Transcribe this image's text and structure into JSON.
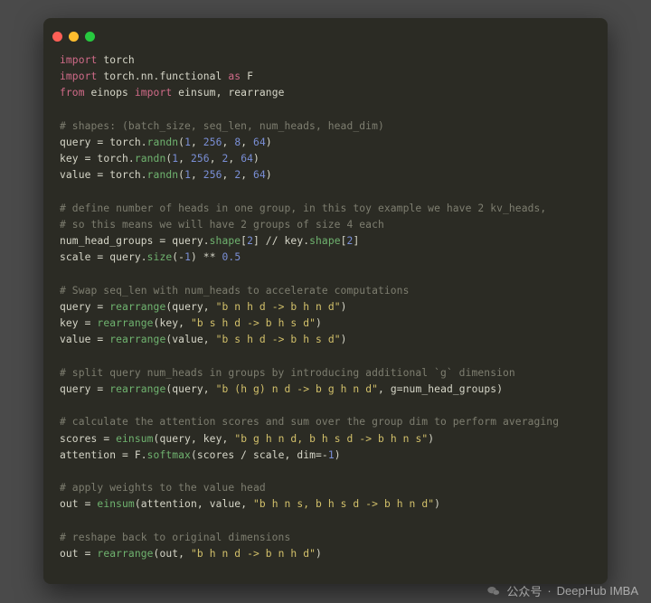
{
  "window": {
    "traffic_lights": [
      "close",
      "minimize",
      "zoom"
    ]
  },
  "code": {
    "lines": [
      [
        [
          "kw",
          "import"
        ],
        [
          "sp",
          " "
        ],
        [
          "mod",
          "torch"
        ]
      ],
      [
        [
          "kw",
          "import"
        ],
        [
          "sp",
          " "
        ],
        [
          "mod",
          "torch.nn.functional"
        ],
        [
          "sp",
          " "
        ],
        [
          "kw",
          "as"
        ],
        [
          "sp",
          " "
        ],
        [
          "mod",
          "F"
        ]
      ],
      [
        [
          "kw",
          "from"
        ],
        [
          "sp",
          " "
        ],
        [
          "mod",
          "einops"
        ],
        [
          "sp",
          " "
        ],
        [
          "kw",
          "import"
        ],
        [
          "sp",
          " "
        ],
        [
          "mod",
          "einsum, rearrange"
        ]
      ],
      [],
      [
        [
          "cmt",
          "# shapes: (batch_size, seq_len, num_heads, head_dim)"
        ]
      ],
      [
        [
          "mod",
          "query "
        ],
        [
          "op",
          "="
        ],
        [
          "sp",
          " "
        ],
        [
          "mod",
          "torch."
        ],
        [
          "fn",
          "randn"
        ],
        [
          "punct",
          "("
        ],
        [
          "num",
          "1"
        ],
        [
          "punct",
          ", "
        ],
        [
          "num",
          "256"
        ],
        [
          "punct",
          ", "
        ],
        [
          "num",
          "8"
        ],
        [
          "punct",
          ", "
        ],
        [
          "num",
          "64"
        ],
        [
          "punct",
          ")"
        ]
      ],
      [
        [
          "mod",
          "key "
        ],
        [
          "op",
          "="
        ],
        [
          "sp",
          " "
        ],
        [
          "mod",
          "torch."
        ],
        [
          "fn",
          "randn"
        ],
        [
          "punct",
          "("
        ],
        [
          "num",
          "1"
        ],
        [
          "punct",
          ", "
        ],
        [
          "num",
          "256"
        ],
        [
          "punct",
          ", "
        ],
        [
          "num",
          "2"
        ],
        [
          "punct",
          ", "
        ],
        [
          "num",
          "64"
        ],
        [
          "punct",
          ")"
        ]
      ],
      [
        [
          "mod",
          "value "
        ],
        [
          "op",
          "="
        ],
        [
          "sp",
          " "
        ],
        [
          "mod",
          "torch."
        ],
        [
          "fn",
          "randn"
        ],
        [
          "punct",
          "("
        ],
        [
          "num",
          "1"
        ],
        [
          "punct",
          ", "
        ],
        [
          "num",
          "256"
        ],
        [
          "punct",
          ", "
        ],
        [
          "num",
          "2"
        ],
        [
          "punct",
          ", "
        ],
        [
          "num",
          "64"
        ],
        [
          "punct",
          ")"
        ]
      ],
      [],
      [
        [
          "cmt",
          "# define number of heads in one group, in this toy example we have 2 kv_heads,"
        ]
      ],
      [
        [
          "cmt",
          "# so this means we will have 2 groups of size 4 each"
        ]
      ],
      [
        [
          "mod",
          "num_head_groups "
        ],
        [
          "op",
          "="
        ],
        [
          "sp",
          " "
        ],
        [
          "mod",
          "query."
        ],
        [
          "fn",
          "shape"
        ],
        [
          "punct",
          "["
        ],
        [
          "num",
          "2"
        ],
        [
          "punct",
          "] "
        ],
        [
          "op",
          "//"
        ],
        [
          "sp",
          " "
        ],
        [
          "mod",
          "key."
        ],
        [
          "fn",
          "shape"
        ],
        [
          "punct",
          "["
        ],
        [
          "num",
          "2"
        ],
        [
          "punct",
          "]"
        ]
      ],
      [
        [
          "mod",
          "scale "
        ],
        [
          "op",
          "="
        ],
        [
          "sp",
          " "
        ],
        [
          "mod",
          "query."
        ],
        [
          "fn",
          "size"
        ],
        [
          "punct",
          "("
        ],
        [
          "op",
          "-"
        ],
        [
          "num",
          "1"
        ],
        [
          "punct",
          ") "
        ],
        [
          "op",
          "**"
        ],
        [
          "sp",
          " "
        ],
        [
          "num",
          "0.5"
        ]
      ],
      [],
      [
        [
          "cmt",
          "# Swap seq_len with num_heads to accelerate computations"
        ]
      ],
      [
        [
          "mod",
          "query "
        ],
        [
          "op",
          "="
        ],
        [
          "sp",
          " "
        ],
        [
          "fn",
          "rearrange"
        ],
        [
          "punct",
          "("
        ],
        [
          "mod",
          "query"
        ],
        [
          "punct",
          ", "
        ],
        [
          "str",
          "\"b n h d -> b h n d\""
        ],
        [
          "punct",
          ")"
        ]
      ],
      [
        [
          "mod",
          "key "
        ],
        [
          "op",
          "="
        ],
        [
          "sp",
          " "
        ],
        [
          "fn",
          "rearrange"
        ],
        [
          "punct",
          "("
        ],
        [
          "mod",
          "key"
        ],
        [
          "punct",
          ", "
        ],
        [
          "str",
          "\"b s h d -> b h s d\""
        ],
        [
          "punct",
          ")"
        ]
      ],
      [
        [
          "mod",
          "value "
        ],
        [
          "op",
          "="
        ],
        [
          "sp",
          " "
        ],
        [
          "fn",
          "rearrange"
        ],
        [
          "punct",
          "("
        ],
        [
          "mod",
          "value"
        ],
        [
          "punct",
          ", "
        ],
        [
          "str",
          "\"b s h d -> b h s d\""
        ],
        [
          "punct",
          ")"
        ]
      ],
      [],
      [
        [
          "cmt",
          "# split query num_heads in groups by introducing additional `g` dimension"
        ]
      ],
      [
        [
          "mod",
          "query "
        ],
        [
          "op",
          "="
        ],
        [
          "sp",
          " "
        ],
        [
          "fn",
          "rearrange"
        ],
        [
          "punct",
          "("
        ],
        [
          "mod",
          "query"
        ],
        [
          "punct",
          ", "
        ],
        [
          "str",
          "\"b (h g) n d -> b g h n d\""
        ],
        [
          "punct",
          ", "
        ],
        [
          "mod",
          "g"
        ],
        [
          "op",
          "="
        ],
        [
          "mod",
          "num_head_groups"
        ],
        [
          "punct",
          ")"
        ]
      ],
      [],
      [
        [
          "cmt",
          "# calculate the attention scores and sum over the group dim to perform averaging"
        ]
      ],
      [
        [
          "mod",
          "scores "
        ],
        [
          "op",
          "="
        ],
        [
          "sp",
          " "
        ],
        [
          "fn",
          "einsum"
        ],
        [
          "punct",
          "("
        ],
        [
          "mod",
          "query"
        ],
        [
          "punct",
          ", "
        ],
        [
          "mod",
          "key"
        ],
        [
          "punct",
          ", "
        ],
        [
          "str",
          "\"b g h n d, b h s d -> b h n s\""
        ],
        [
          "punct",
          ")"
        ]
      ],
      [
        [
          "mod",
          "attention "
        ],
        [
          "op",
          "="
        ],
        [
          "sp",
          " "
        ],
        [
          "mod",
          "F."
        ],
        [
          "fn",
          "softmax"
        ],
        [
          "punct",
          "("
        ],
        [
          "mod",
          "scores "
        ],
        [
          "op",
          "/"
        ],
        [
          "sp",
          " "
        ],
        [
          "mod",
          "scale"
        ],
        [
          "punct",
          ", "
        ],
        [
          "mod",
          "dim"
        ],
        [
          "op",
          "=-"
        ],
        [
          "num",
          "1"
        ],
        [
          "punct",
          ")"
        ]
      ],
      [],
      [
        [
          "cmt",
          "# apply weights to the value head"
        ]
      ],
      [
        [
          "mod",
          "out "
        ],
        [
          "op",
          "="
        ],
        [
          "sp",
          " "
        ],
        [
          "fn",
          "einsum"
        ],
        [
          "punct",
          "("
        ],
        [
          "mod",
          "attention"
        ],
        [
          "punct",
          ", "
        ],
        [
          "mod",
          "value"
        ],
        [
          "punct",
          ", "
        ],
        [
          "str",
          "\"b h n s, b h s d -> b h n d\""
        ],
        [
          "punct",
          ")"
        ]
      ],
      [],
      [
        [
          "cmt",
          "# reshape back to original dimensions"
        ]
      ],
      [
        [
          "mod",
          "out "
        ],
        [
          "op",
          "="
        ],
        [
          "sp",
          " "
        ],
        [
          "fn",
          "rearrange"
        ],
        [
          "punct",
          "("
        ],
        [
          "mod",
          "out"
        ],
        [
          "punct",
          ", "
        ],
        [
          "str",
          "\"b h n d -> b n h d\""
        ],
        [
          "punct",
          ")"
        ]
      ]
    ]
  },
  "footer": {
    "prefix_label": "公众号",
    "separator": " · ",
    "brand": "DeepHub IMBA"
  }
}
